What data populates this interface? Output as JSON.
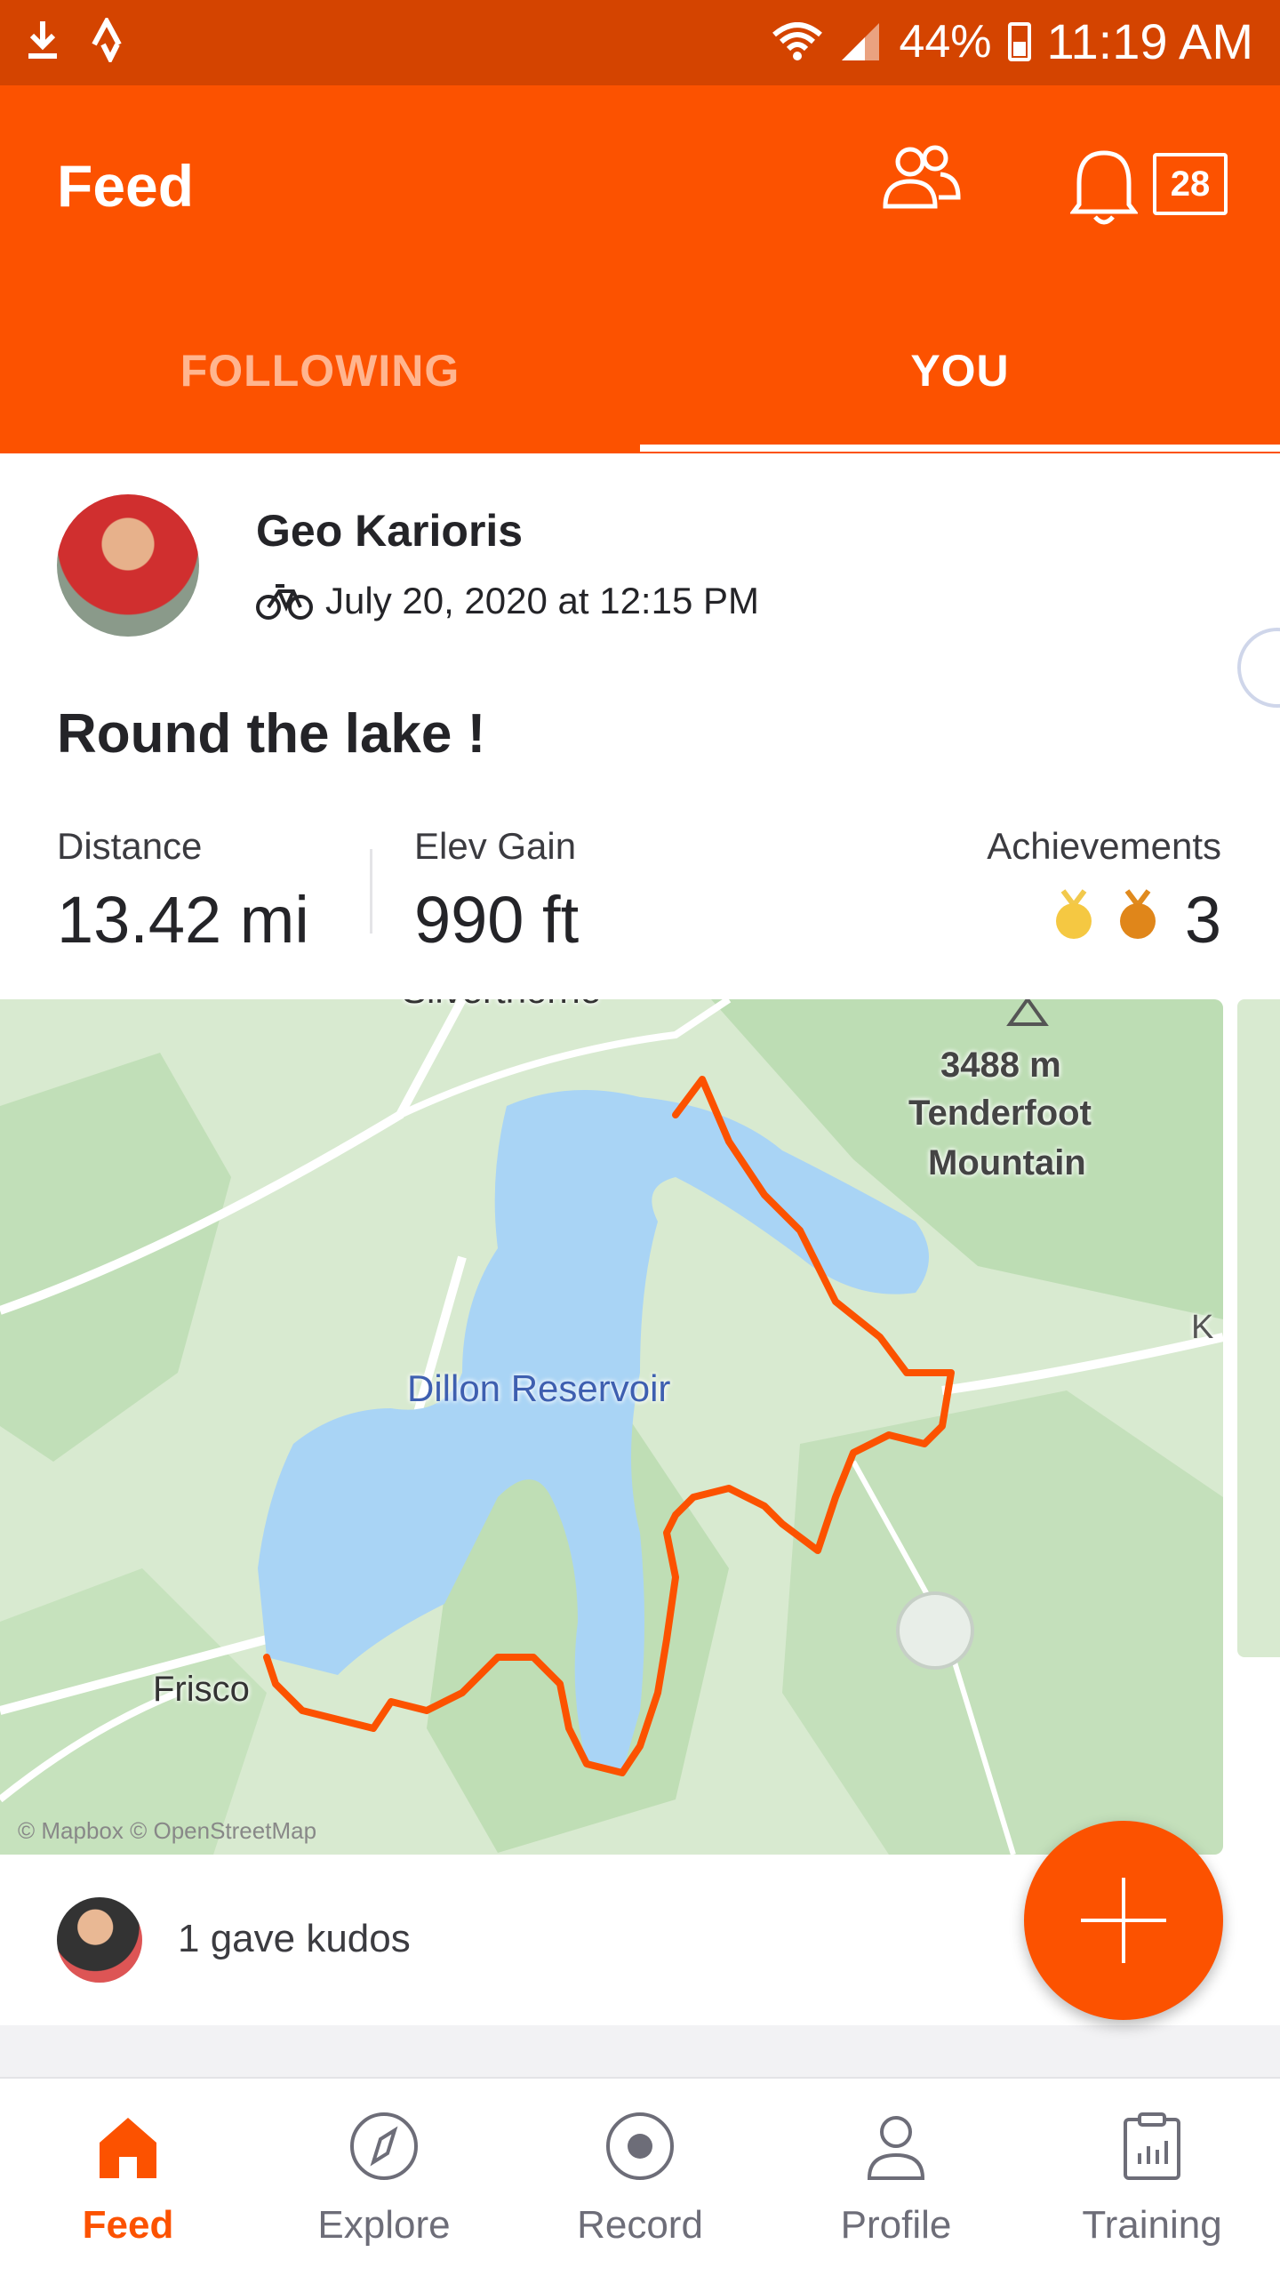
{
  "status_bar": {
    "battery_percent": "44%",
    "time": "11:19 AM"
  },
  "header": {
    "title": "Feed",
    "notifications_count": "28",
    "tabs": [
      {
        "label": "FOLLOWING",
        "selected": false
      },
      {
        "label": "YOU",
        "selected": true
      }
    ]
  },
  "activity": {
    "athlete_name": "Geo Karioris",
    "date": "July 20, 2020 at 12:15 PM",
    "sport_icon": "bike-icon",
    "title": "Round the lake !",
    "stats": {
      "distance_label": "Distance",
      "distance_value": "13.42 mi",
      "elev_label": "Elev Gain",
      "elev_value": "990 ft",
      "achievements_label": "Achievements",
      "achievements_value": "3"
    },
    "map": {
      "labels": {
        "town_top": "Silverthorne",
        "peak_elevation": "3488 m",
        "peak_name_1": "Tenderfoot",
        "peak_name_2": "Mountain",
        "lake": "Dillon Reservoir",
        "town_left": "Frisco",
        "edge": "K",
        "attribution": "© Mapbox © OpenStreetMap"
      }
    },
    "kudos_text": "1 gave kudos"
  },
  "bottom_nav": [
    {
      "label": "Feed",
      "icon": "home-icon",
      "active": true
    },
    {
      "label": "Explore",
      "icon": "compass-icon",
      "active": false
    },
    {
      "label": "Record",
      "icon": "record-icon",
      "active": false
    },
    {
      "label": "Profile",
      "icon": "person-icon",
      "active": false
    },
    {
      "label": "Training",
      "icon": "clipboard-chart-icon",
      "active": false
    }
  ],
  "colors": {
    "brand": "#fc5200",
    "status_bar": "#d44400",
    "route": "#fc5200",
    "water": "#a9d4f5",
    "land": "#d8ead0"
  }
}
